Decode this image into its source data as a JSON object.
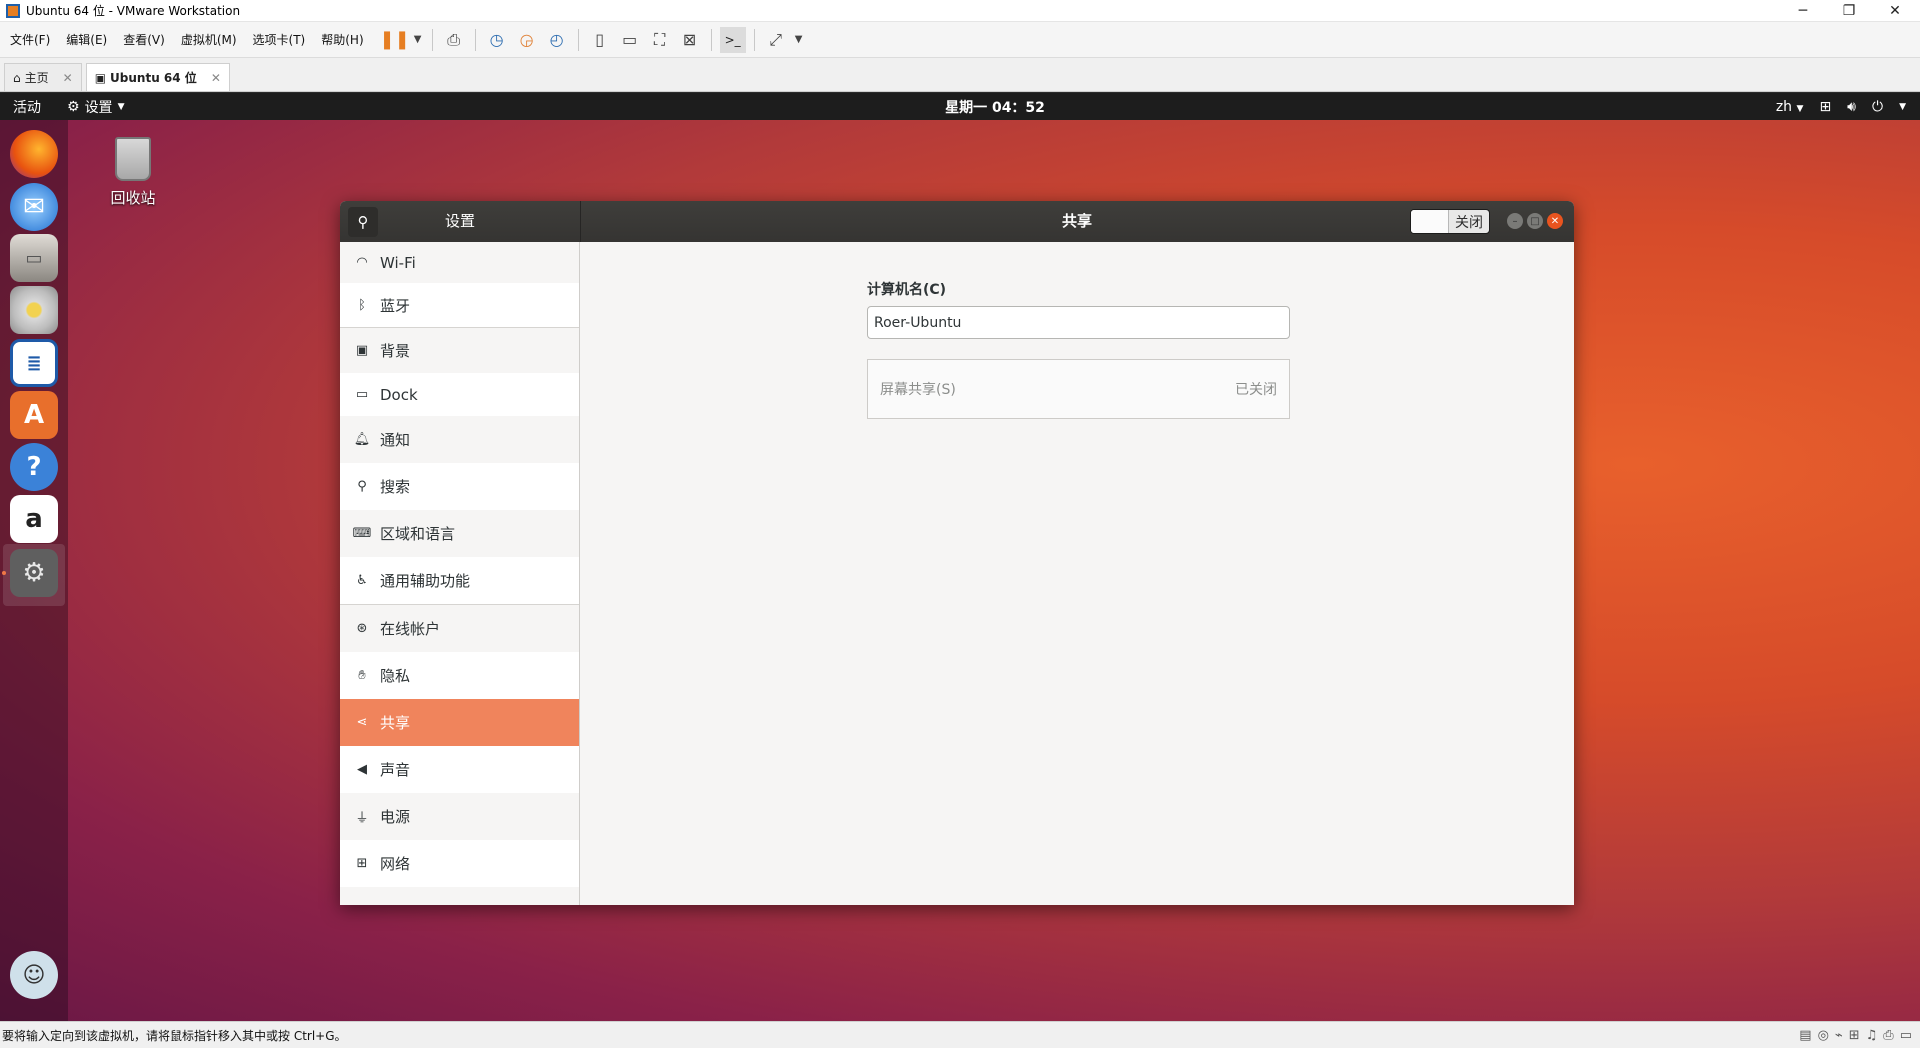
{
  "host": {
    "title": "Ubuntu 64 位 - VMware Workstation",
    "window_controls": {
      "minimize": "─",
      "restore": "❐",
      "close": "✕"
    },
    "menus": [
      "文件(F)",
      "编辑(E)",
      "查看(V)",
      "虚拟机(M)",
      "选项卡(T)",
      "帮助(H)"
    ],
    "tabs": [
      {
        "label": "主页",
        "close": "✕"
      },
      {
        "label": "Ubuntu 64 位",
        "close": "✕"
      }
    ],
    "status_text": "要将输入定向到该虚拟机，请将鼠标指针移入其中或按 Ctrl+G。",
    "accent": "#2c6cb0"
  },
  "guest": {
    "topbar": {
      "activities": "活动",
      "app_menu": "设置",
      "clock": "星期一 04：52",
      "lang": "zh"
    },
    "desktop": {
      "trash_label": "回收站"
    },
    "dock_icons": [
      "firefox-icon",
      "thunderbird-icon",
      "files-icon",
      "rhythmbox-icon",
      "libreoffice-writer-icon",
      "software-center-icon",
      "help-icon",
      "amazon-icon",
      "settings-icon",
      "user-avatar-icon"
    ]
  },
  "settings": {
    "sidebar_title": "设置",
    "page_title": "共享",
    "toggle_label": "关闭",
    "sidebar_items": [
      {
        "label": "Wi-Fi",
        "icon": "wifi-icon"
      },
      {
        "label": "蓝牙",
        "icon": "bluetooth-icon"
      },
      {
        "label": "背景",
        "icon": "background-icon"
      },
      {
        "label": "Dock",
        "icon": "dock-icon"
      },
      {
        "label": "通知",
        "icon": "bell-icon"
      },
      {
        "label": "搜索",
        "icon": "search-icon"
      },
      {
        "label": "区域和语言",
        "icon": "region-icon"
      },
      {
        "label": "通用辅助功能",
        "icon": "accessibility-icon"
      },
      {
        "label": "在线帐户",
        "icon": "online-accounts-icon"
      },
      {
        "label": "隐私",
        "icon": "hand-icon"
      },
      {
        "label": "共享",
        "icon": "share-icon"
      },
      {
        "label": "声音",
        "icon": "speaker-icon"
      },
      {
        "label": "电源",
        "icon": "power-plug-icon"
      },
      {
        "label": "网络",
        "icon": "network-icon"
      }
    ],
    "selected": "共享",
    "computer_name_label": "计算机名(C)",
    "computer_name_value": "Roer-Ubuntu",
    "screen_sharing_label": "屏幕共享(S)",
    "screen_sharing_status": "已关闭",
    "selected_color": "#f0845c"
  }
}
